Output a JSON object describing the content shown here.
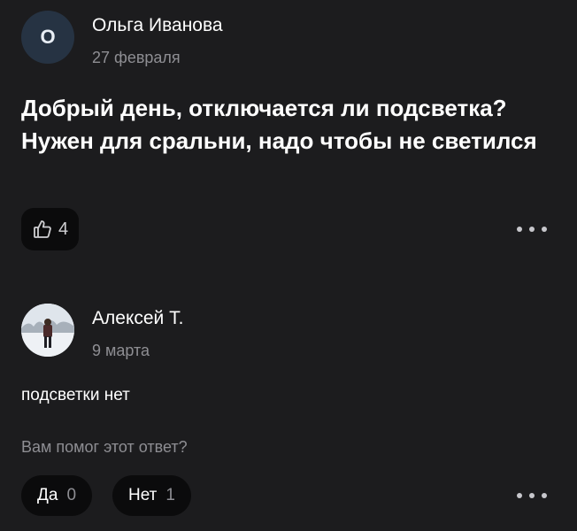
{
  "question": {
    "author_initial": "О",
    "author_name": "Ольга Иванова",
    "date": "27 февраля",
    "text": "Добрый день, отключается ли подсветка? Нужен для сральни, надо чтобы не светился",
    "likes": "4"
  },
  "answer": {
    "author_name": "Алексей Т.",
    "date": "9 марта",
    "text": "подсветки нет",
    "helpful_prompt": "Вам помог этот ответ?",
    "yes_label": "Да",
    "yes_count": "0",
    "no_label": "Нет",
    "no_count": "1"
  },
  "icons": {
    "like": "thumbs-up-icon",
    "more": "more-horizontal-icon"
  },
  "colors": {
    "background": "#1c1c1e",
    "button_bg": "#0b0b0c",
    "avatar_bg": "#263343",
    "muted_text": "#8e8e93"
  }
}
